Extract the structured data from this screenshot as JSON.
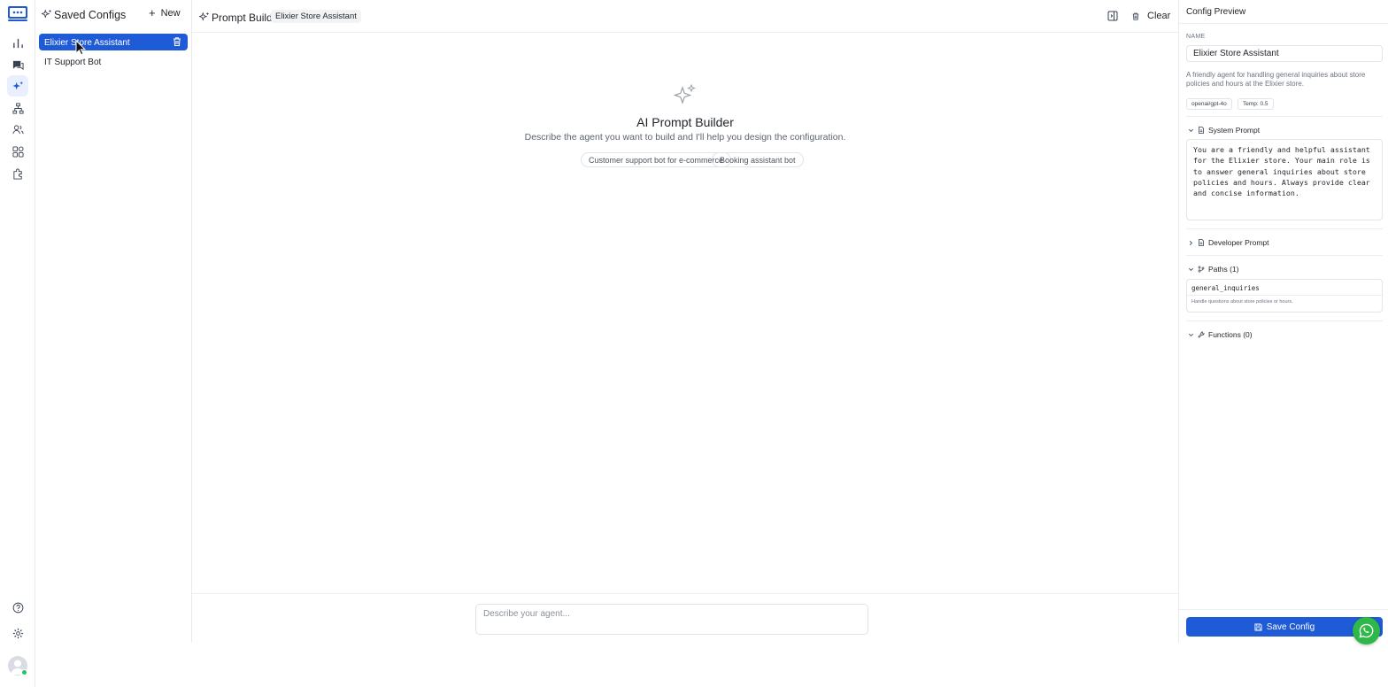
{
  "saved_configs": {
    "title": "Saved Configs",
    "new_label": "New",
    "items": [
      {
        "label": "Elixier Store Assistant",
        "active": true
      },
      {
        "label": "IT Support Bot",
        "active": false
      }
    ]
  },
  "header": {
    "title": "Prompt Builder",
    "active_config": "Elixier Store Assistant",
    "clear_label": "Clear"
  },
  "hero": {
    "title": "AI Prompt Builder",
    "subtitle": "Describe the agent you want to build and I'll help you design the configuration.",
    "suggestions": [
      "Customer support bot for e-commerce",
      "Booking assistant bot"
    ]
  },
  "composer": {
    "placeholder": "Describe your agent..."
  },
  "preview": {
    "title": "Config Preview",
    "name_label": "NAME",
    "name": "Elixier Store Assistant",
    "description": "A friendly agent for handling general inquiries about store policies and hours at the Elixier store.",
    "model": "openai/gpt-4o",
    "temperature": "Temp: 0.5",
    "system_prompt_label": "System Prompt",
    "system_prompt": "You are a friendly and helpful assistant for the Elixier store. Your main role is to answer general inquiries about store policies and hours. Always provide clear and concise information.",
    "developer_prompt_label": "Developer Prompt",
    "paths_label": "Paths (1)",
    "paths": [
      {
        "name": "general_inquiries",
        "description": "Handle questions about store policies or hours."
      }
    ],
    "functions_label": "Functions (0)",
    "save_label": "Save Config"
  },
  "colors": {
    "accent": "#1f5bd6",
    "whatsapp": "#2fb84a",
    "online": "#22c55e"
  }
}
